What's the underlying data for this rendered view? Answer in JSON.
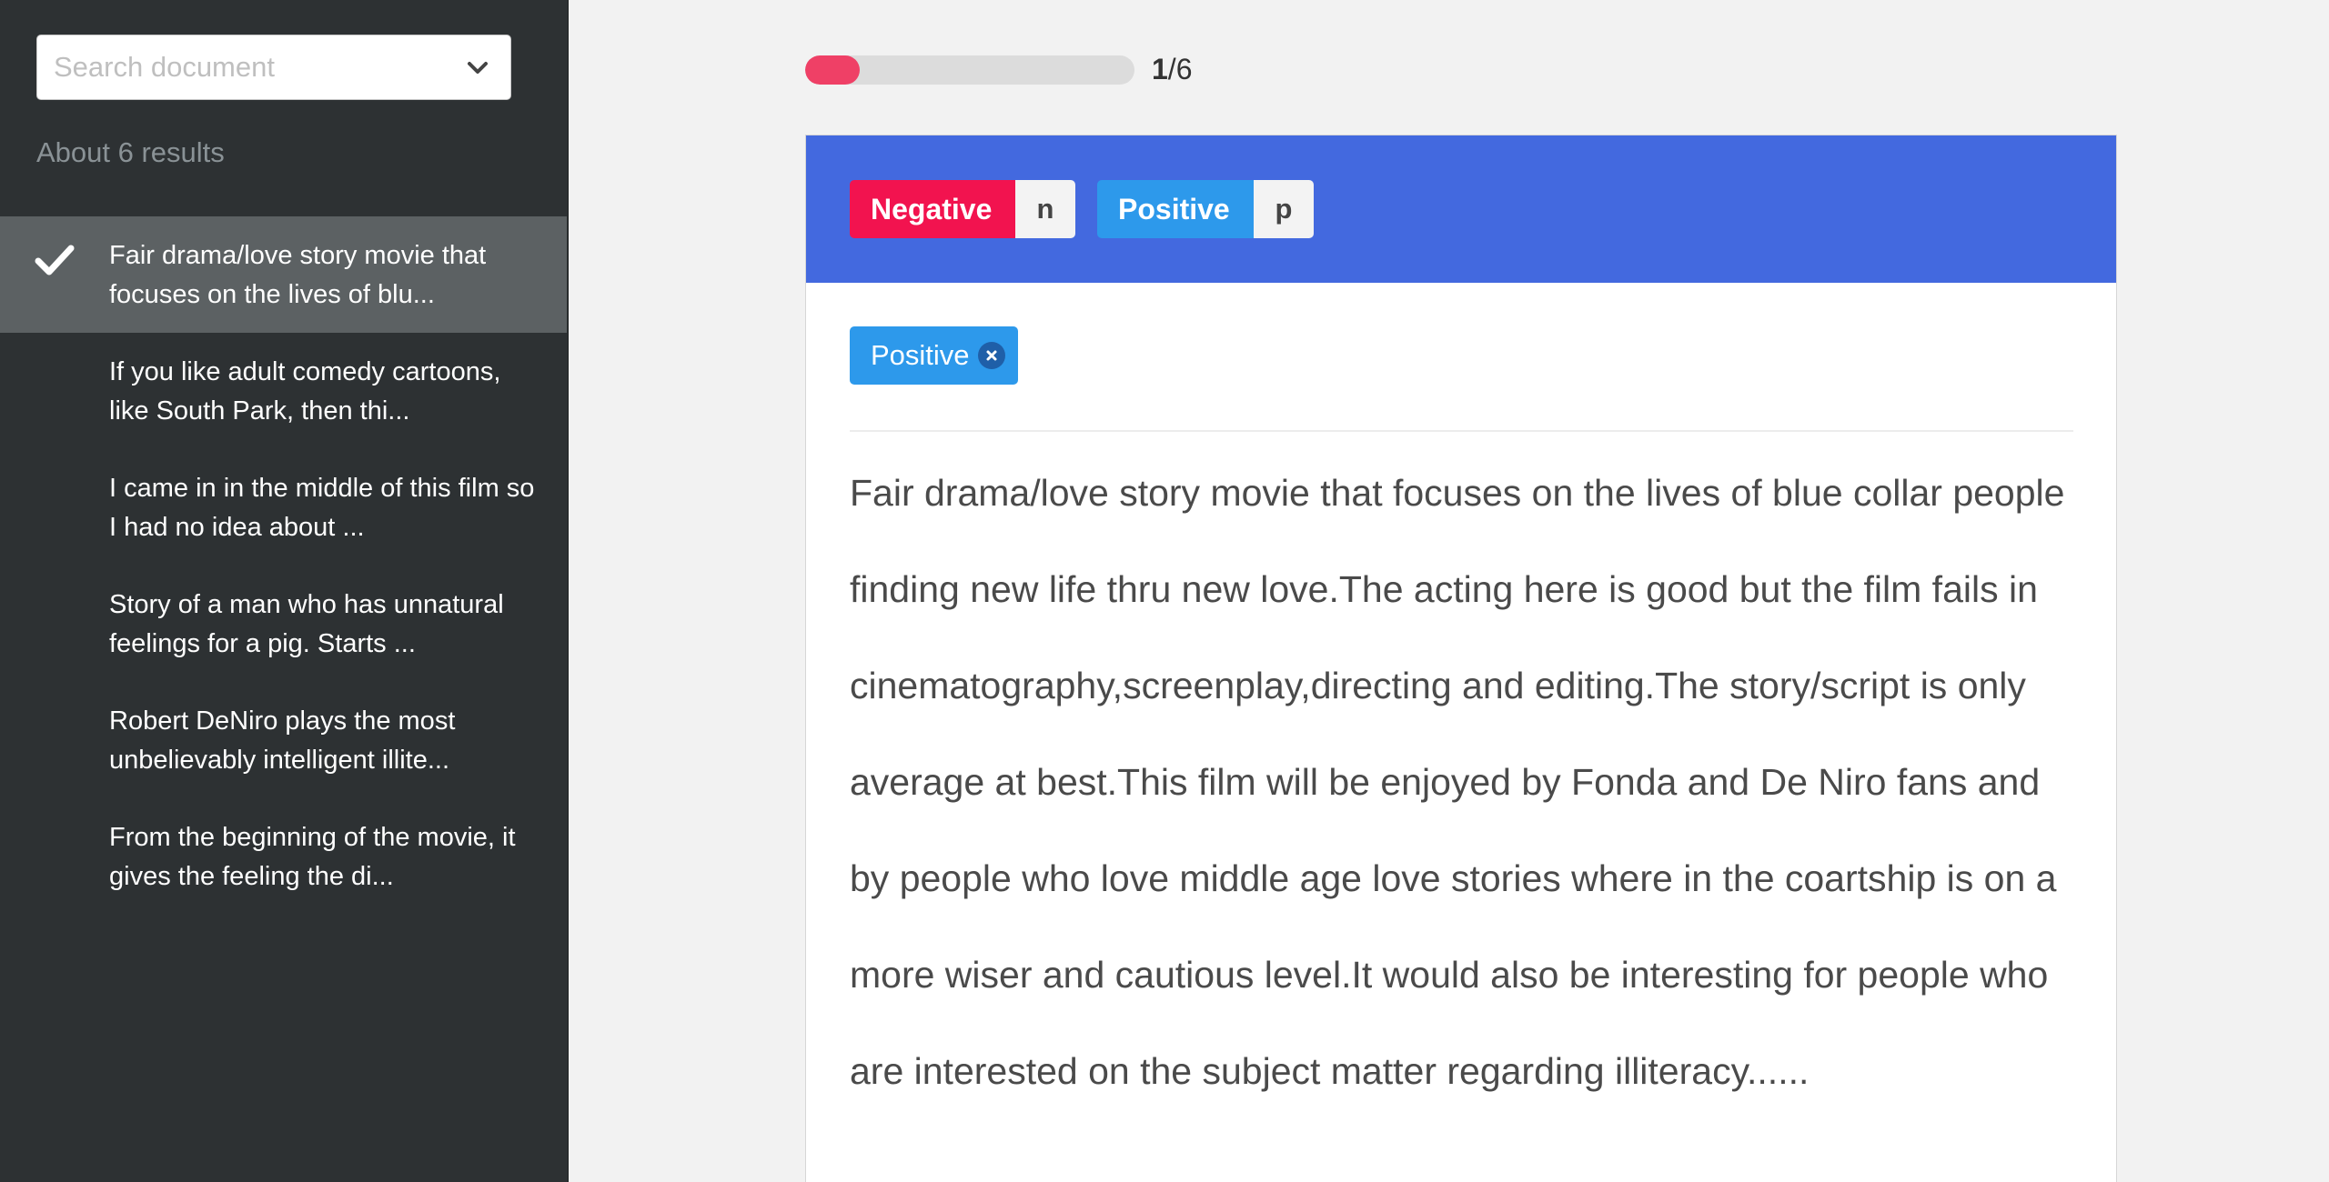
{
  "sidebar": {
    "search": {
      "placeholder": "Search document",
      "value": ""
    },
    "results_count": "About 6 results",
    "documents": [
      {
        "text": "Fair drama/love story movie that focuses on the lives of blu...",
        "active": true
      },
      {
        "text": "If you like adult comedy cartoons, like South Park, then thi...",
        "active": false
      },
      {
        "text": "I came in in the middle of this film so I had no idea about ...",
        "active": false
      },
      {
        "text": "Story of a man who has unnatural feelings for a pig. Starts ...",
        "active": false
      },
      {
        "text": "Robert DeNiro plays the most unbelievably intelligent illite...",
        "active": false
      },
      {
        "text": "From the beginning of the movie, it gives the feeling the di...",
        "active": false
      }
    ]
  },
  "progress": {
    "current": "1",
    "separator": "/",
    "total": "6",
    "fraction": 0.1667,
    "color": "#ef4066"
  },
  "labels": [
    {
      "name": "Negative",
      "shortcut": "n",
      "color": "#f2134f"
    },
    {
      "name": "Positive",
      "shortcut": "p",
      "color": "#2d99eb"
    }
  ],
  "header_color": "#4369df",
  "assigned_tags": [
    {
      "label": "Positive",
      "icon": "close-icon"
    }
  ],
  "document_text": "Fair drama/love story movie that focuses on the lives of blue collar people finding new life thru new love.The acting here is good but the film fails in cinematography,screenplay,directing and editing.The story/script is only average at best.This film will be enjoyed by Fonda and De Niro fans and by people who love middle age love stories where in the coartship is on a more wiser and cautious level.It would also be interesting for people who are interested on the subject matter regarding illiteracy......"
}
